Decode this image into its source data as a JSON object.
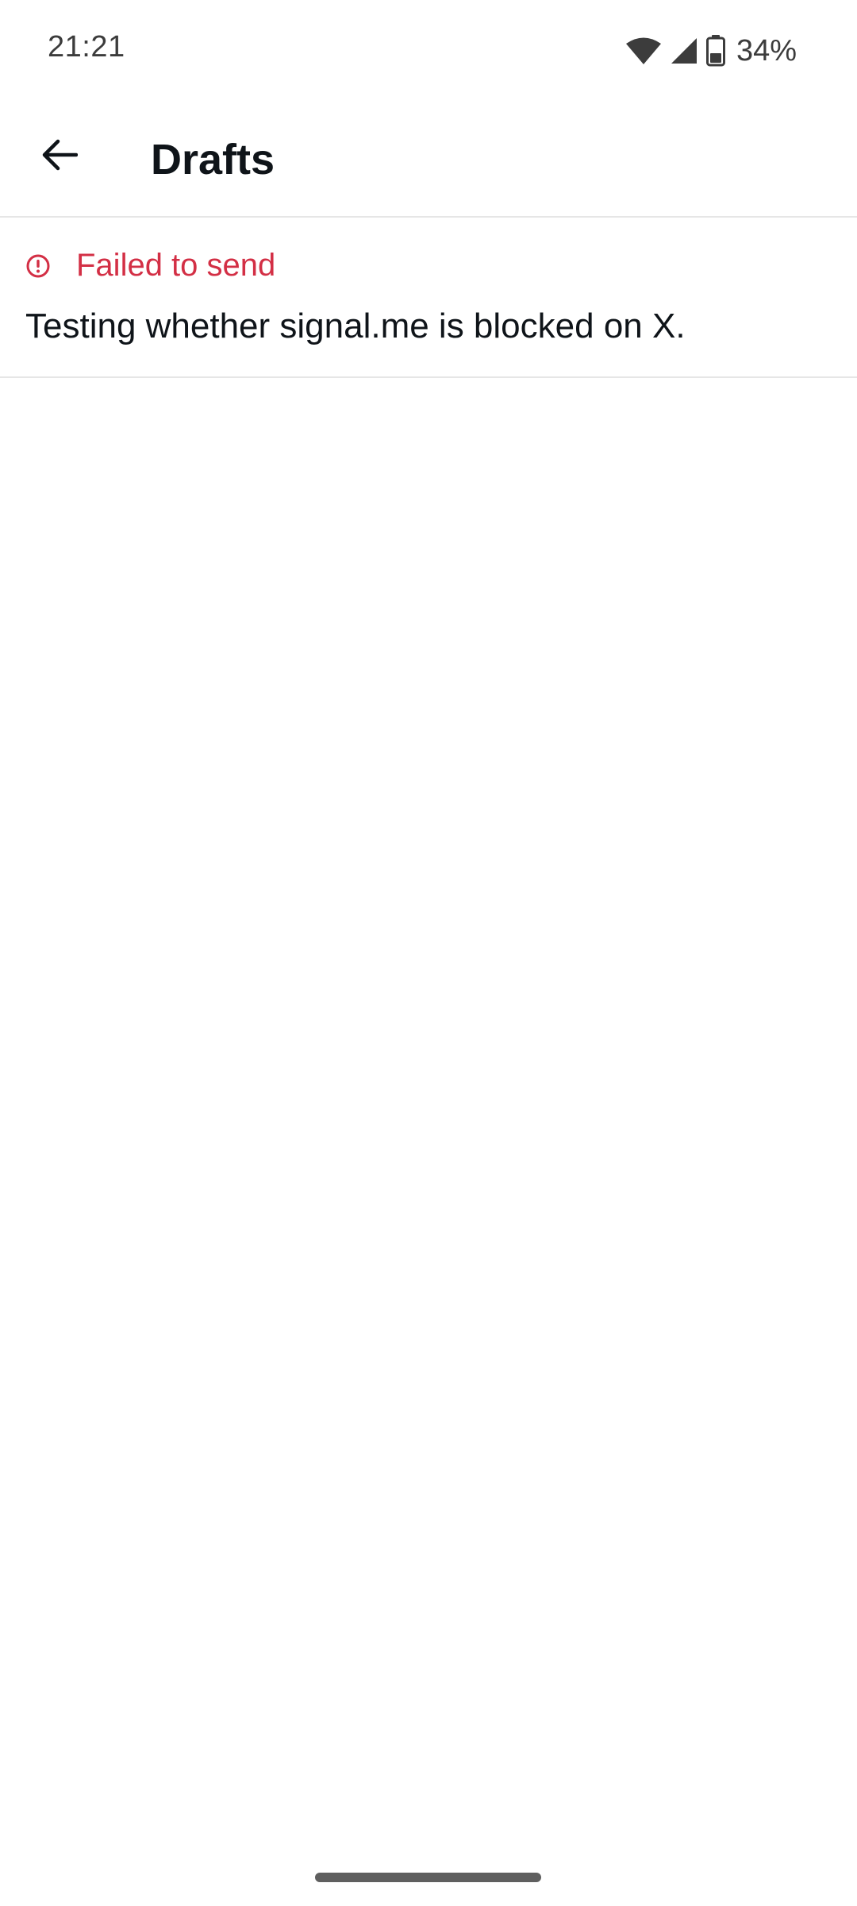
{
  "status_bar": {
    "time": "21:21",
    "battery": "34%",
    "icons": [
      "wifi-icon",
      "cell-signal-icon",
      "battery-icon"
    ]
  },
  "app_bar": {
    "title": "Drafts",
    "back_icon": "arrow-left-icon"
  },
  "drafts": [
    {
      "status": "Failed to send",
      "status_icon": "error-circle-icon",
      "text": "Testing whether signal.me is blocked on X."
    }
  ],
  "colors": {
    "error": "#d32f45",
    "text": "#0f1419",
    "divider": "#e6e6e6"
  }
}
